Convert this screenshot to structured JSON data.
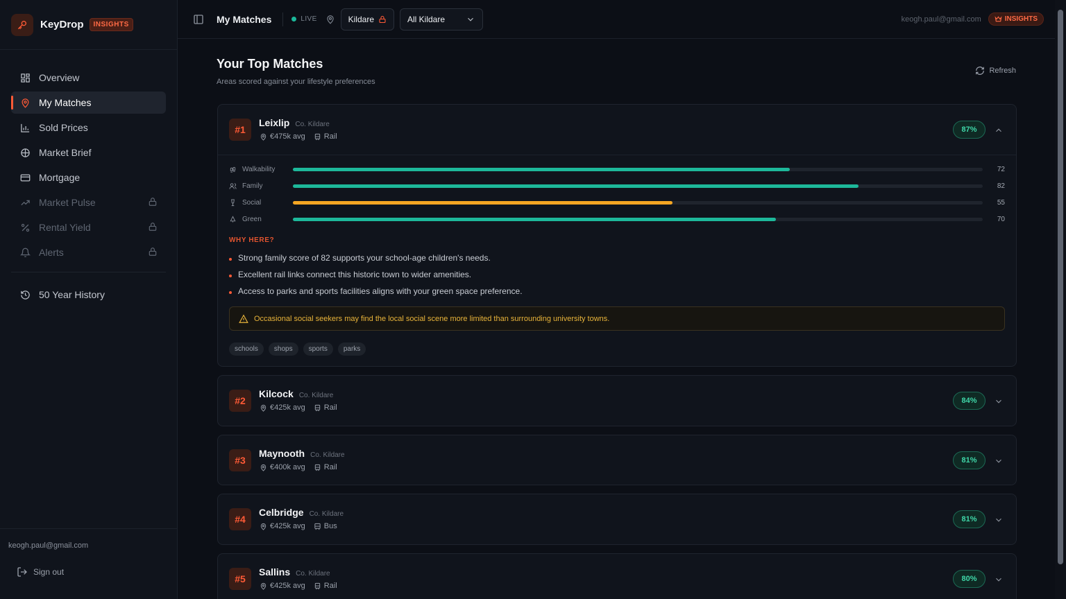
{
  "brand": {
    "name": "KeyDrop",
    "badge": "INSIGHTS",
    "accent": "#ff5a36"
  },
  "sidebar": {
    "items": [
      {
        "label": "Overview",
        "icon": "grid-icon"
      },
      {
        "label": "My Matches",
        "icon": "map-pin-icon",
        "active": true
      },
      {
        "label": "Sold Prices",
        "icon": "bar-chart-icon"
      },
      {
        "label": "Market Brief",
        "icon": "globe-icon"
      },
      {
        "label": "Mortgage",
        "icon": "credit-card-icon"
      },
      {
        "label": "Market Pulse",
        "icon": "trending-up-icon",
        "locked": true
      },
      {
        "label": "Rental Yield",
        "icon": "percent-icon",
        "locked": true
      },
      {
        "label": "Alerts",
        "icon": "bell-icon",
        "locked": true
      }
    ],
    "history": {
      "label": "50 Year History",
      "icon": "history-icon"
    },
    "user_email": "keogh.paul@gmail.com",
    "signout_label": "Sign out"
  },
  "topbar": {
    "title": "My Matches",
    "live_label": "LIVE",
    "county_chip": "Kildare",
    "area_select": "All Kildare",
    "email": "keogh.paul@gmail.com",
    "badge": "INSIGHTS"
  },
  "page": {
    "title": "Your Top Matches",
    "subtitle": "Areas scored against your lifestyle preferences",
    "refresh_label": "Refresh"
  },
  "matches": [
    {
      "rank": "#1",
      "name": "Leixlip",
      "county": "Co. Kildare",
      "price": "€475k avg",
      "transport": "Rail",
      "score": "87%",
      "expanded": true,
      "metrics": [
        {
          "label": "Walkability",
          "value": 72,
          "color": "#1db89a",
          "icon": "footprints-icon"
        },
        {
          "label": "Family",
          "value": 82,
          "color": "#1db89a",
          "icon": "users-icon"
        },
        {
          "label": "Social",
          "value": 55,
          "color": "#f5a623",
          "icon": "wine-icon"
        },
        {
          "label": "Green",
          "value": 70,
          "color": "#1db89a",
          "icon": "tree-icon"
        }
      ],
      "why_label": "WHY HERE?",
      "reasons": [
        "Strong family score of 82 supports your school-age children's needs.",
        "Excellent rail links connect this historic town to wider amenities.",
        "Access to parks and sports facilities aligns with your green space preference."
      ],
      "warning": "Occasional social seekers may find the local social scene more limited than surrounding university towns.",
      "tags": [
        "schools",
        "shops",
        "sports",
        "parks"
      ]
    },
    {
      "rank": "#2",
      "name": "Kilcock",
      "county": "Co. Kildare",
      "price": "€425k avg",
      "transport": "Rail",
      "score": "84%"
    },
    {
      "rank": "#3",
      "name": "Maynooth",
      "county": "Co. Kildare",
      "price": "€400k avg",
      "transport": "Rail",
      "score": "81%"
    },
    {
      "rank": "#4",
      "name": "Celbridge",
      "county": "Co. Kildare",
      "price": "€425k avg",
      "transport": "Bus",
      "score": "81%"
    },
    {
      "rank": "#5",
      "name": "Sallins",
      "county": "Co. Kildare",
      "price": "€425k avg",
      "transport": "Rail",
      "score": "80%"
    }
  ]
}
